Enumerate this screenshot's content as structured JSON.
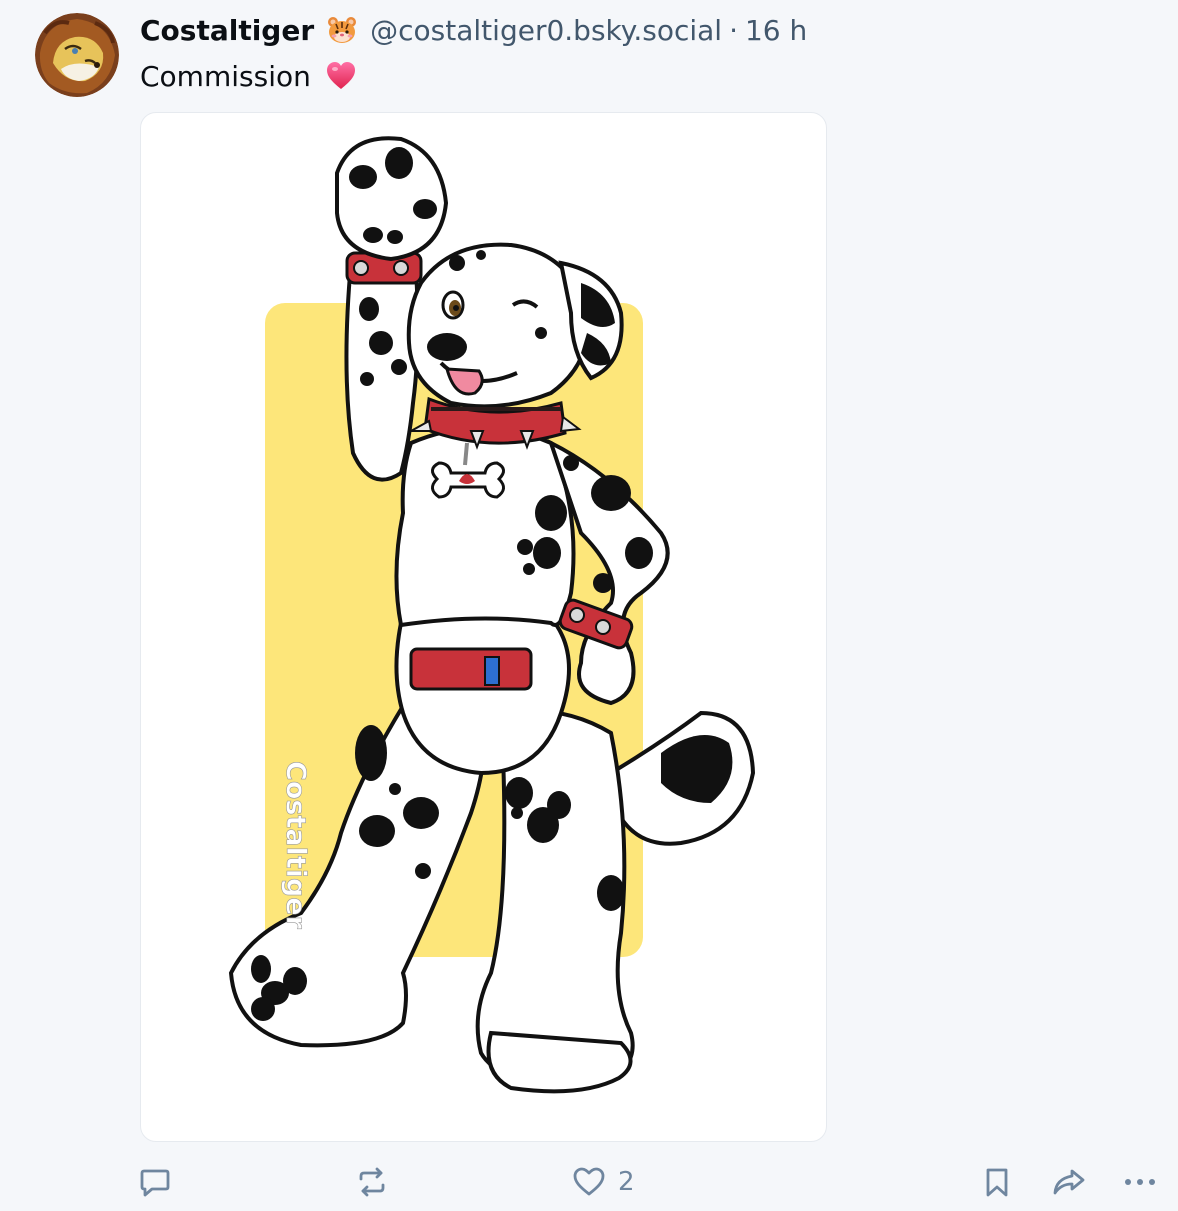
{
  "author": {
    "display_name": "Costaltiger",
    "handle": "@costaltiger0.bsky.social",
    "separator": "·",
    "timestamp": "16 h",
    "avatar_icon": "lion-avatar",
    "badge_icon": "tiger-face-emoji"
  },
  "post": {
    "text": "Commission",
    "emoji_icon": "heart-emoji",
    "image_watermark": "Costaltiger"
  },
  "actions": {
    "reply_icon": "reply-icon",
    "repost_icon": "repost-icon",
    "like_icon": "like-icon",
    "like_count": "2",
    "bookmark_icon": "bookmark-icon",
    "share_icon": "share-icon",
    "more_icon": "more-icon"
  },
  "colors": {
    "background": "#f5f7fa",
    "text_primary": "#0b0f14",
    "text_secondary": "#42576c",
    "icon": "#6f869f",
    "image_backdrop": "#fde67a",
    "collar_red": "#c8323a"
  }
}
